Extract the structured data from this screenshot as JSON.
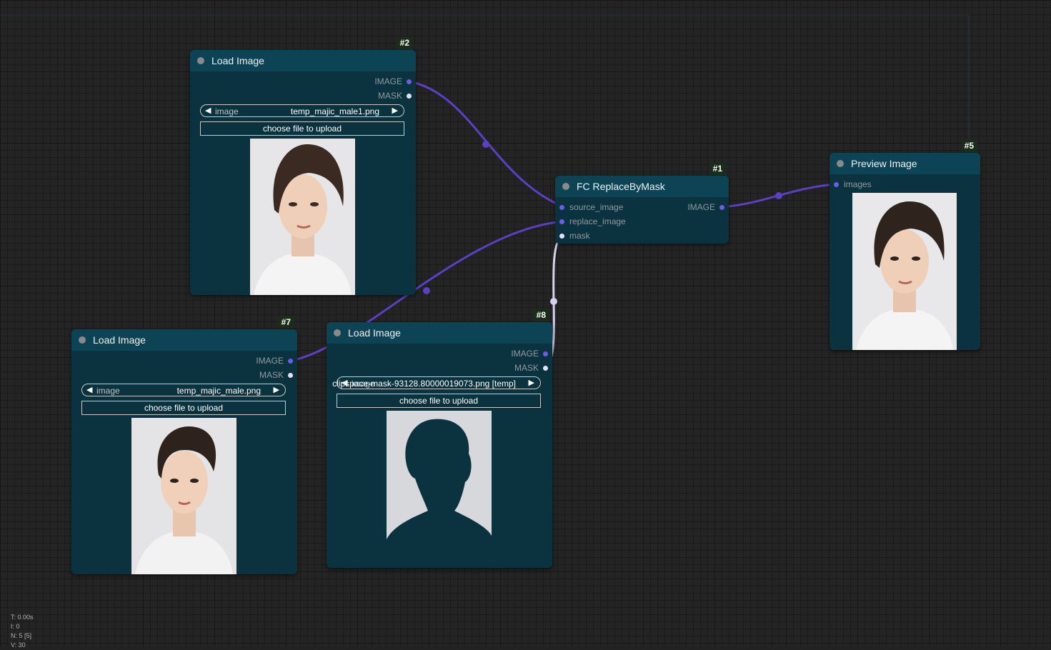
{
  "nodes": {
    "n2": {
      "id": "#2",
      "title": "Load Image",
      "outputs": [
        "IMAGE",
        "MASK"
      ],
      "combo_label": "image",
      "combo_value": "temp_majic_male1.png",
      "upload_label": "choose file to upload"
    },
    "n7": {
      "id": "#7",
      "title": "Load Image",
      "outputs": [
        "IMAGE",
        "MASK"
      ],
      "combo_label": "image",
      "combo_value": "temp_majic_male.png",
      "upload_label": "choose file to upload"
    },
    "n8": {
      "id": "#8",
      "title": "Load Image",
      "outputs": [
        "IMAGE",
        "MASK"
      ],
      "combo_label": "image",
      "combo_value": "clipspace-mask-93128.80000019073.png [temp]",
      "upload_label": "choose file to upload"
    },
    "n1": {
      "id": "#1",
      "title": "FC ReplaceByMask",
      "inputs": [
        "source_image",
        "replace_image",
        "mask"
      ],
      "outputs": [
        "IMAGE"
      ]
    },
    "n5": {
      "id": "#5",
      "title": "Preview Image",
      "inputs": [
        "images"
      ]
    }
  },
  "stats": {
    "t": "T: 0.00s",
    "i": "I: 0",
    "n": "N: 5 [5]",
    "v": "V: 30"
  },
  "colors": {
    "canvas": "#222222",
    "node_body": "#0b323f",
    "node_title": "#0d4455",
    "image_link": "#5b3fc4",
    "mask_link": "#d6d0ee"
  }
}
